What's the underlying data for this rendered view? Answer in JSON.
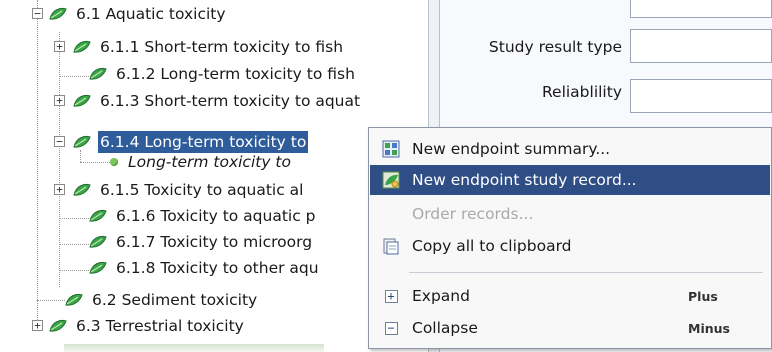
{
  "tree": {
    "items": [
      {
        "label": "6.1 Aquatic toxicity",
        "toggle": "⊟"
      },
      {
        "label": "6.1.1 Short-term toxicity to fish",
        "toggle": "⊞"
      },
      {
        "label": "6.1.2 Long-term toxicity to fish",
        "toggle": ""
      },
      {
        "label": "6.1.3 Short-term toxicity to aquat",
        "toggle": "⊞"
      },
      {
        "label": "6.1.4 Long-term toxicity to",
        "toggle": "⊟"
      },
      {
        "label": "Long-term toxicity to",
        "toggle": ""
      },
      {
        "label": "6.1.5 Toxicity to aquatic al",
        "toggle": "⊞"
      },
      {
        "label": "6.1.6 Toxicity to aquatic p",
        "toggle": ""
      },
      {
        "label": "6.1.7 Toxicity to microorg",
        "toggle": ""
      },
      {
        "label": "6.1.8 Toxicity to other aqu",
        "toggle": ""
      },
      {
        "label": "6.2 Sediment toxicity",
        "toggle": ""
      },
      {
        "label": "6.3 Terrestrial toxicity",
        "toggle": "⊞"
      }
    ]
  },
  "form": {
    "fields": [
      {
        "label": "Study result type",
        "value": ""
      },
      {
        "label": "Reliablility",
        "value": ""
      }
    ]
  },
  "context_menu": {
    "items": [
      {
        "label": "New endpoint summary...",
        "icon": "endpoint-summary-icon",
        "shortcut": ""
      },
      {
        "label": "New endpoint study record...",
        "icon": "endpoint-study-record-icon",
        "shortcut": ""
      },
      {
        "label": "Order records...",
        "icon": "",
        "shortcut": ""
      },
      {
        "label": "Copy all to clipboard",
        "icon": "clipboard-icon",
        "shortcut": ""
      },
      {
        "label": "Expand",
        "icon": "expand-icon",
        "shortcut": "Plus"
      },
      {
        "label": "Collapse",
        "icon": "collapse-icon",
        "shortcut": "Minus"
      }
    ]
  },
  "colors": {
    "selection": "#2f5d9c",
    "menu_highlight": "#2f4e86",
    "leaf_green": "#3aa44a",
    "disabled_text": "#a9a9a9"
  }
}
